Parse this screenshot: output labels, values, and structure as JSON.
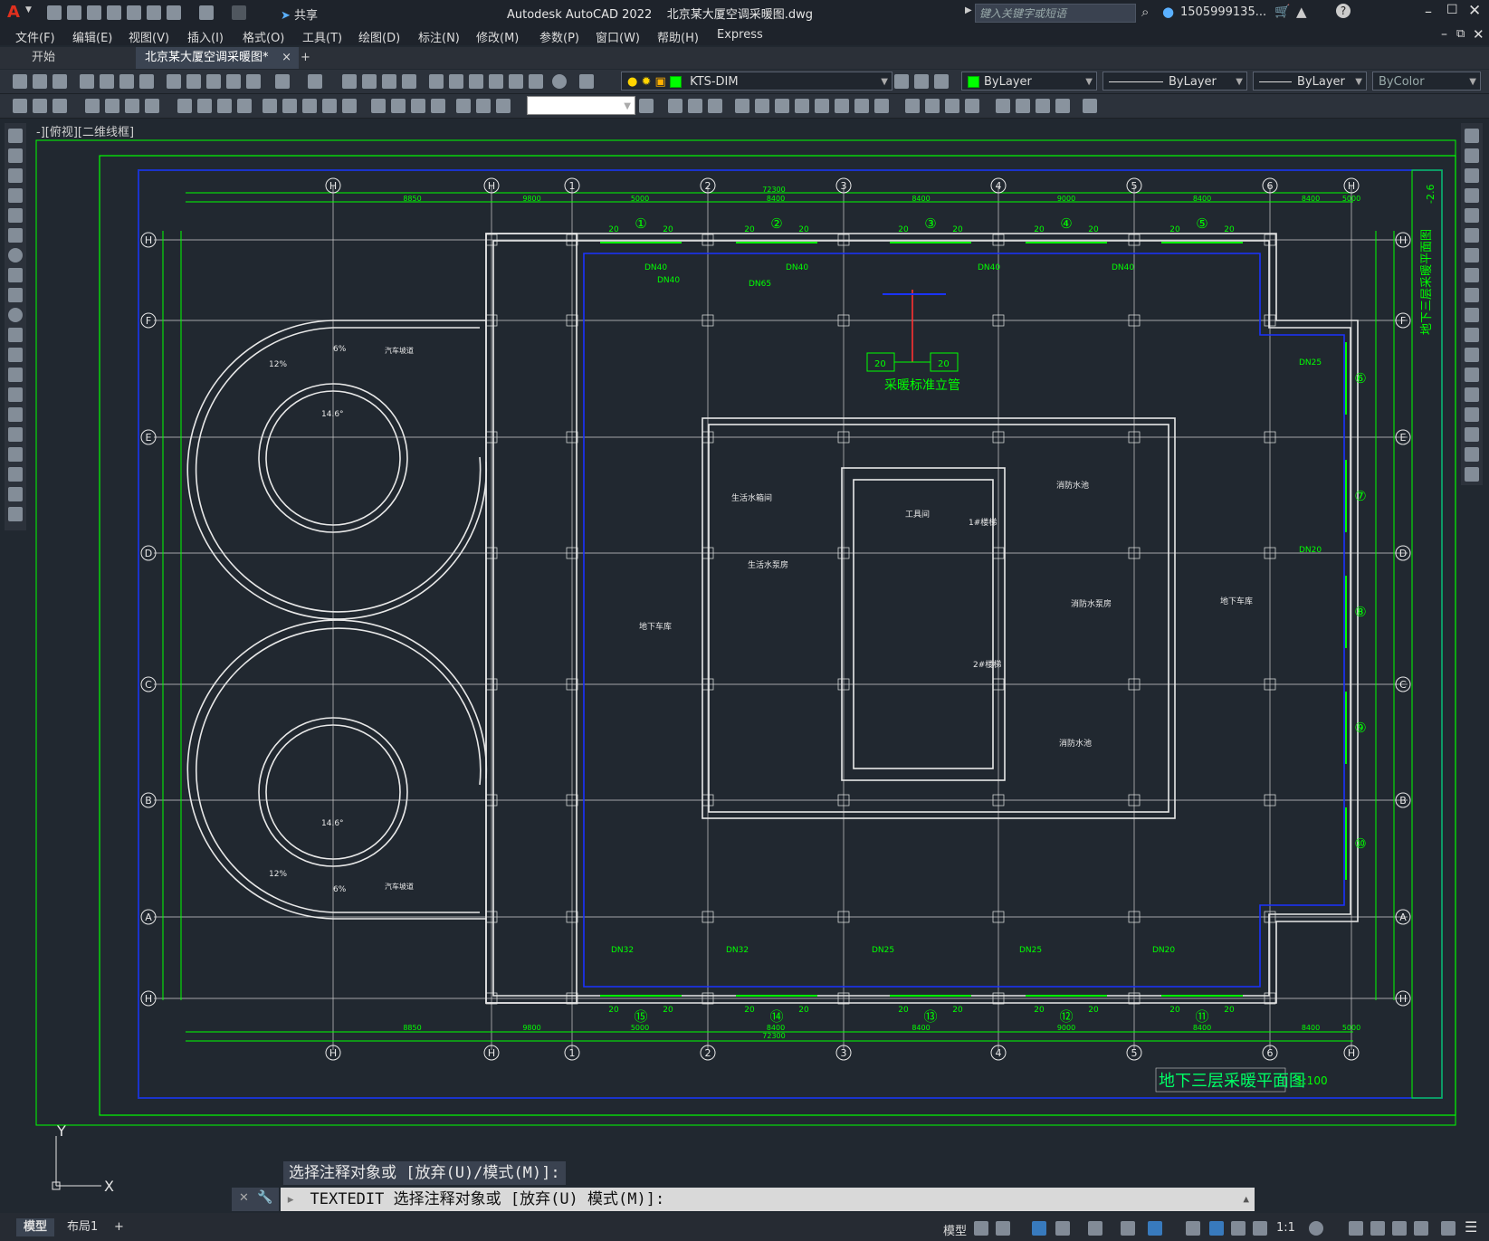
{
  "app": {
    "title": "Autodesk AutoCAD 2022    北京某大厦空调采暖图.dwg",
    "search_placeholder": "键入关键字或短语",
    "user": "1505999135...",
    "share": "共享",
    "logo": "A"
  },
  "menu": [
    "文件(F)",
    "编辑(E)",
    "视图(V)",
    "插入(I)",
    "格式(O)",
    "工具(T)",
    "绘图(D)",
    "标注(N)",
    "修改(M)",
    "参数(P)",
    "窗口(W)",
    "帮助(H)",
    "Express"
  ],
  "tabs": {
    "start": "开始",
    "active": "北京某大厦空调采暖图*",
    "close_glyph": "×",
    "add_glyph": "+"
  },
  "toolbar": {
    "layer": "KTS-DIM",
    "color": "ByLayer",
    "linetype": "ByLayer",
    "lineweight": "ByLayer",
    "plotstyle": "ByColor",
    "dimstyle": ""
  },
  "viewport": {
    "label": "-][俯视][二维线框]"
  },
  "drawing": {
    "title": "地下三层采暖平面图",
    "scale": "1:100",
    "grid_top": [
      "H",
      "H",
      "1",
      "2",
      "3",
      "4",
      "5",
      "6",
      "H"
    ],
    "grid_left": [
      "H",
      "F",
      "E",
      "D",
      "C",
      "B",
      "A",
      "H"
    ],
    "riser_label": "采暖标准立管",
    "rooms": [
      "生活水箱间",
      "生活水泵房",
      "工具间",
      "1#楼梯",
      "消防水池",
      "消防水泵房",
      "地下车库",
      "地下车库",
      "2#楼梯",
      "消防水池"
    ],
    "pipe_labels": [
      "DN40",
      "DN40",
      "DN65",
      "DN40",
      "DN40",
      "DN40",
      "DN32",
      "DN32",
      "DN25",
      "DN25",
      "DN20",
      "DN25",
      "DN20"
    ],
    "ramp_pct": [
      "12%",
      "6%",
      "14.6°",
      "12%",
      "6%",
      "14.6°"
    ],
    "ramp_text": [
      "汽车坡道",
      "汽车坡道"
    ],
    "branch_ids_top": [
      "①",
      "②",
      "③",
      "④",
      "⑤"
    ],
    "branch_ids_bottom": [
      "⑮",
      "⑭",
      "⑬",
      "⑫",
      "⑪"
    ],
    "branch_ids_right": [
      "⑥",
      "⑦",
      "⑧",
      "⑨",
      "⑩"
    ],
    "dim_total": "72300",
    "dims_top": [
      "8850",
      "9800",
      "5000",
      "8400",
      "8400",
      "9000",
      "8400",
      "8400",
      "5000"
    ],
    "side_title": "地下三层采暖平面图",
    "level": "-2.6",
    "ucs_x": "X",
    "ucs_y": "Y",
    "twenty": "20"
  },
  "command": {
    "history": "选择注释对象或 [放弃(U)/模式(M)]:",
    "current": "TEXTEDIT 选择注释对象或 [放弃(U) 模式(M)]:"
  },
  "status": {
    "model_tab": "模型",
    "layout_tab": "布局1",
    "add": "+",
    "model_btn": "模型",
    "scale": "1:1"
  }
}
